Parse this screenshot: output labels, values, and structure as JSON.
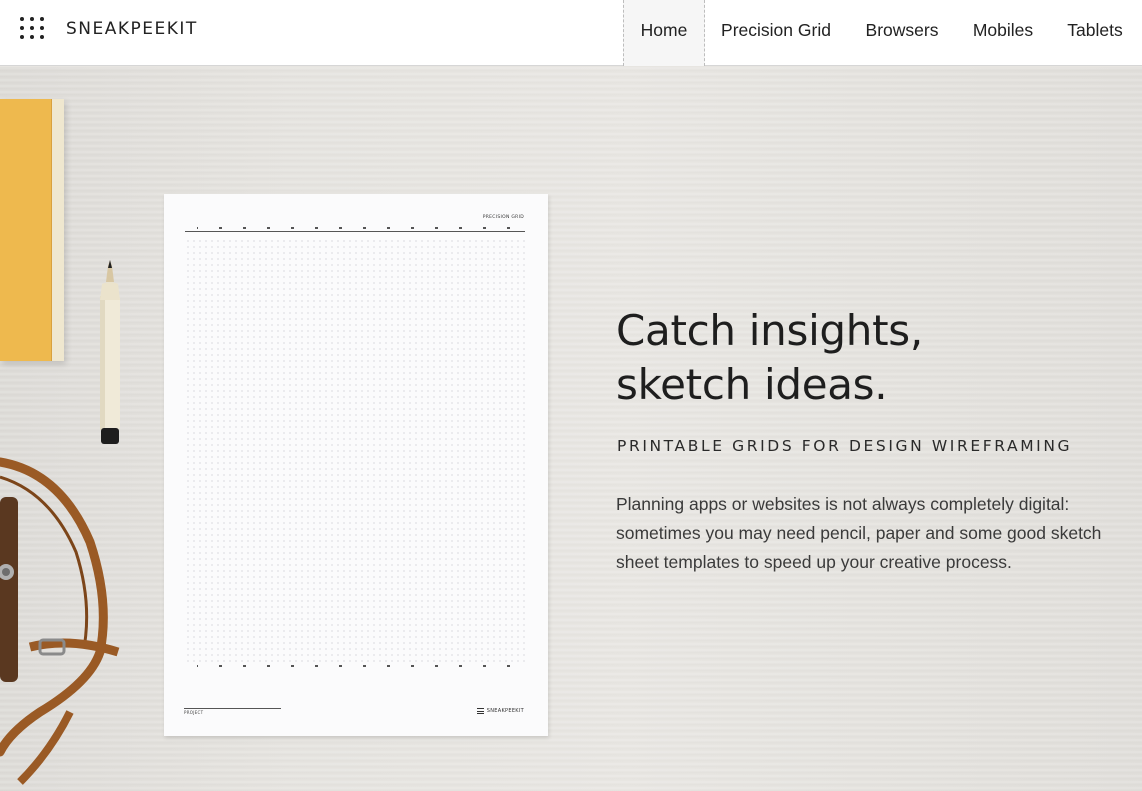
{
  "header": {
    "logo_text": "SNEAKPEEKIT",
    "logo_icon": "dots-grid-icon",
    "nav": [
      {
        "label": "Home",
        "active": true
      },
      {
        "label": "Precision Grid"
      },
      {
        "label": "Browsers"
      },
      {
        "label": "Mobiles"
      },
      {
        "label": "Tablets"
      }
    ]
  },
  "hero": {
    "headline_line1": "Catch insights,",
    "headline_line2": "sketch ideas.",
    "tagline": "PRINTABLE GRIDS FOR DESIGN WIREFRAMING",
    "description": "Planning apps or websites is not always completely digital: sometimes you may need pencil, paper and some good sketch sheet templates to speed up your creative process."
  },
  "sheet": {
    "title": "PRECISION GRID",
    "project_label": "PROJECT",
    "brand": "SNEAKPEEKIT"
  },
  "colors": {
    "background": "#e7e5e1",
    "notebook": "#eeb94e",
    "strap": "#9a5a25",
    "text": "#1e1e1e"
  }
}
